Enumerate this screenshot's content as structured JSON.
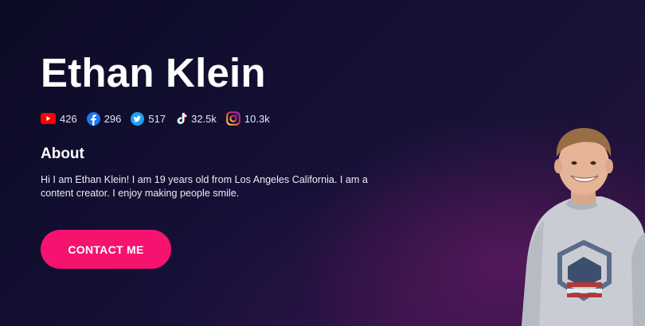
{
  "profile": {
    "name": "Ethan Klein"
  },
  "socials": [
    {
      "icon": "youtube-icon",
      "count": "426",
      "color": "#ff0000"
    },
    {
      "icon": "facebook-icon",
      "count": "296",
      "color": "#1877f2"
    },
    {
      "icon": "twitter-icon",
      "count": "517",
      "color": "#1da1f2"
    },
    {
      "icon": "tiktok-icon",
      "count": "32.5k",
      "color": "#ffffff"
    },
    {
      "icon": "instagram-icon",
      "count": "10.3k",
      "color": "#e1306c"
    }
  ],
  "about": {
    "heading": "About",
    "text": "Hi I am Ethan Klein! I am 19 years old from Los Angeles California. I am a content creator. I enjoy making people smile."
  },
  "cta": {
    "label": "CONTACT ME",
    "color": "#f5136f"
  },
  "theme": {
    "background": "#120f30",
    "accent": "#f5136f"
  }
}
